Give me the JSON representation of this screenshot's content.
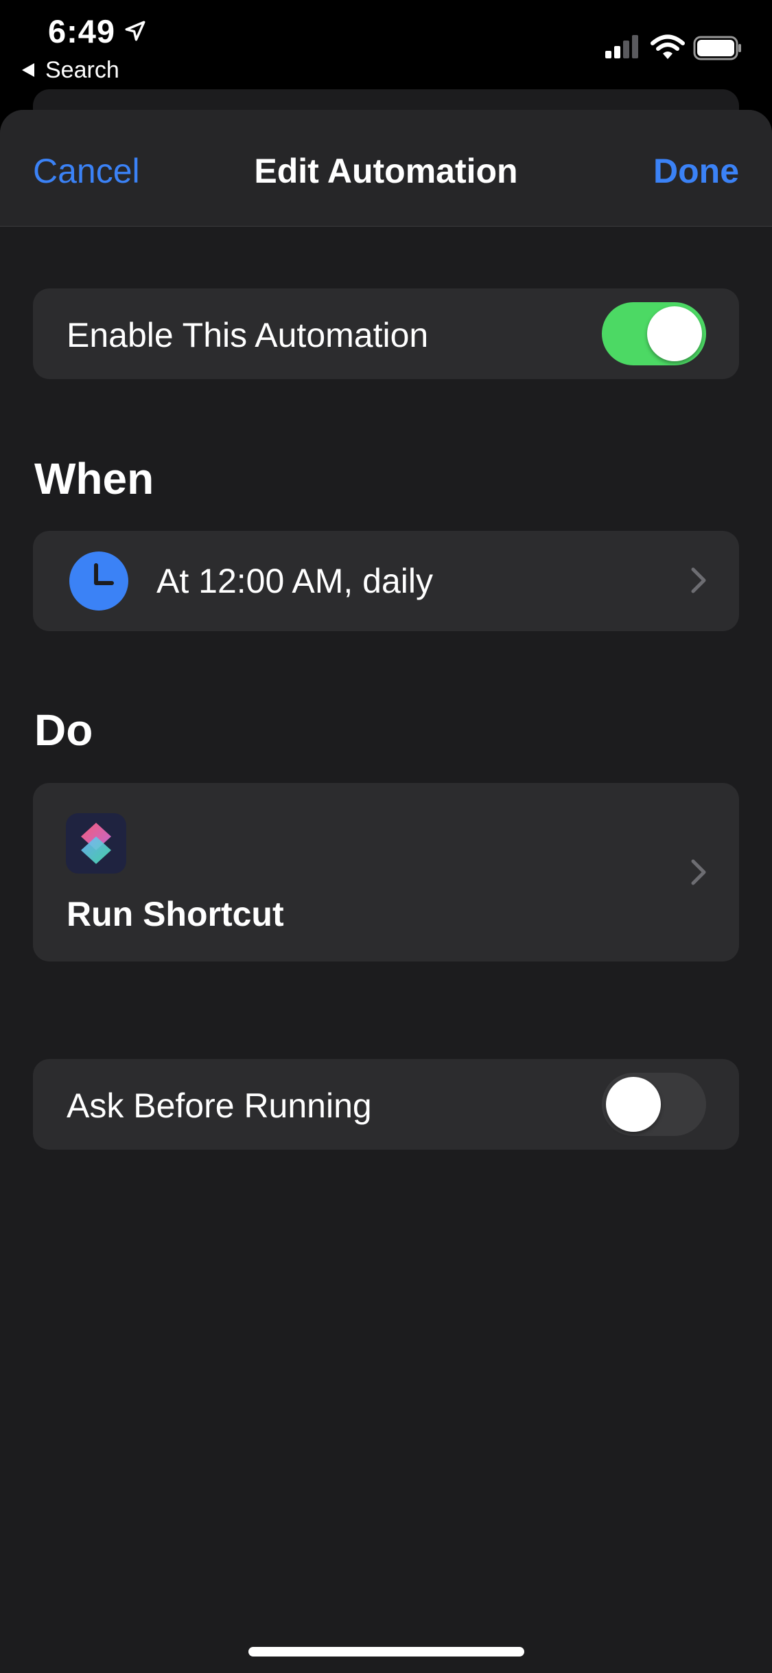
{
  "status_bar": {
    "time": "6:49",
    "back_label": "Search",
    "icons": [
      "location-arrow-icon",
      "cellular-signal-icon",
      "wifi-icon",
      "battery-icon"
    ]
  },
  "navbar": {
    "cancel_label": "Cancel",
    "title": "Edit Automation",
    "done_label": "Done"
  },
  "enable": {
    "label": "Enable This Automation",
    "toggle_on": true
  },
  "when": {
    "header": "When",
    "trigger_label": "At 12:00 AM, daily",
    "icon": "clock-icon"
  },
  "do": {
    "header": "Do",
    "action_label": "Run Shortcut",
    "icon": "shortcuts-app-icon"
  },
  "ask": {
    "label": "Ask Before Running",
    "toggle_on": false
  },
  "colors": {
    "accent": "#3b82f6",
    "toggle_on": "#4cd964",
    "card": "#2c2c2e",
    "sheet": "#1c1c1e"
  }
}
